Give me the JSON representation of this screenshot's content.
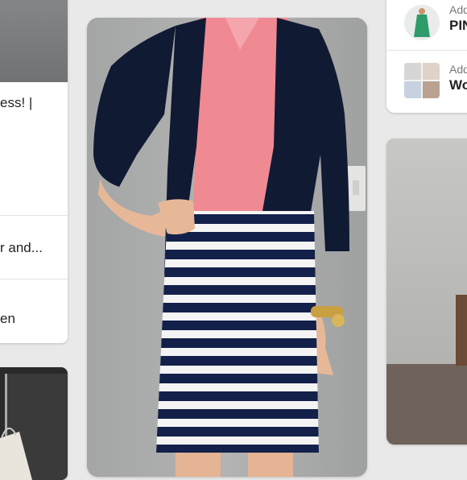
{
  "left_card": {
    "line1": "ess! |",
    "line2": "r and...",
    "line3": "en"
  },
  "right_card": {
    "row1_small": "Add",
    "row1_big": "PIN",
    "row2_small": "Add",
    "row2_big": "Wo"
  }
}
